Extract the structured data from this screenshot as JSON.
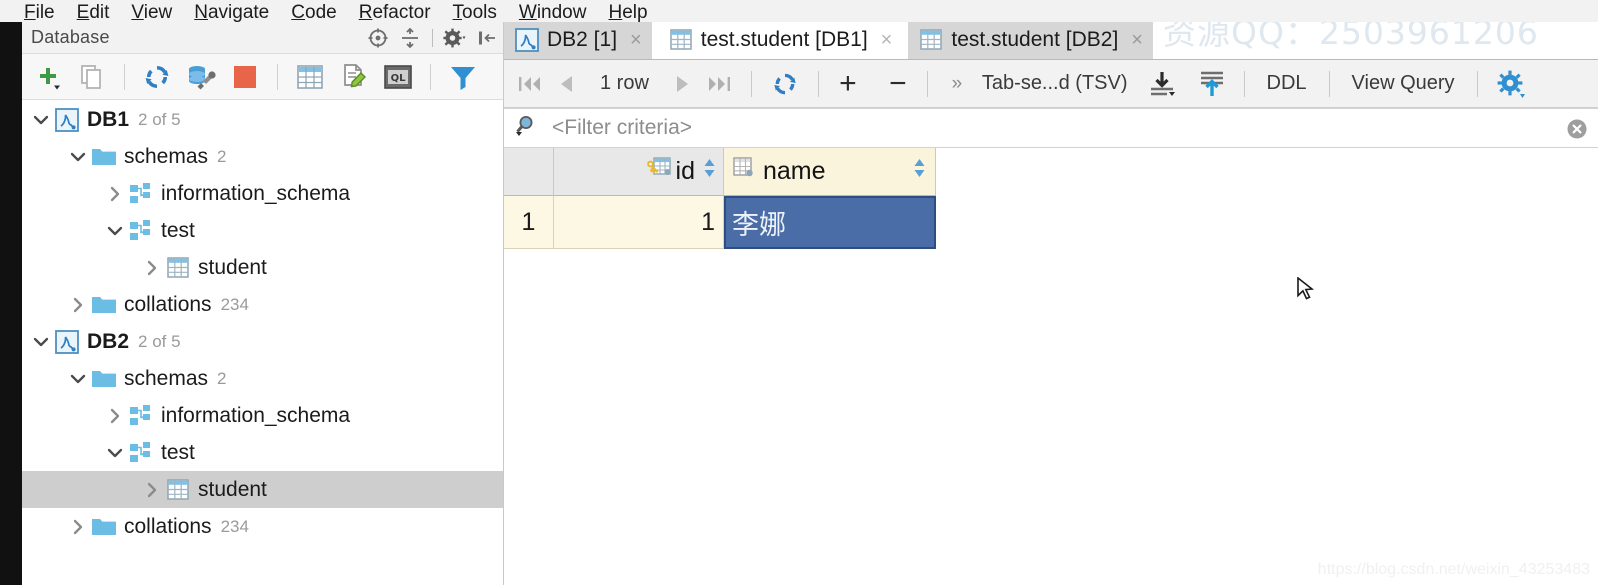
{
  "menubar": {
    "items": [
      {
        "mnemonic": "F",
        "rest": "ile"
      },
      {
        "mnemonic": "E",
        "rest": "dit"
      },
      {
        "mnemonic": "V",
        "rest": "iew"
      },
      {
        "mnemonic": "N",
        "rest": "avigate"
      },
      {
        "mnemonic": "C",
        "rest": "ode"
      },
      {
        "mnemonic": "R",
        "rest": "efactor"
      },
      {
        "mnemonic": "T",
        "rest": "ools"
      },
      {
        "mnemonic": "W",
        "rest": "indow"
      },
      {
        "mnemonic": "H",
        "rest": "elp"
      }
    ]
  },
  "database_panel": {
    "title": "Database",
    "header_icons": [
      "locate-icon",
      "collapse-all-icon",
      "settings-gear-icon",
      "hide-panel-icon"
    ],
    "toolbar_icons": [
      "add-plus-icon",
      "duplicate-icon",
      "synchronize-icon",
      "data-source-properties-icon",
      "stop-icon",
      "table-editor-icon",
      "modify-table-icon",
      "sql-console-icon",
      "filter-icon"
    ],
    "tree": [
      {
        "label": "DB1",
        "count": "2 of 5",
        "icon": "mysql-datasource-icon",
        "depth": 0,
        "expanded": true,
        "bold": true,
        "selected": false
      },
      {
        "label": "schemas",
        "count": "2",
        "icon": "folder-icon",
        "depth": 1,
        "expanded": true,
        "bold": false,
        "selected": false
      },
      {
        "label": "information_schema",
        "count": "",
        "icon": "schema-icon",
        "depth": 2,
        "expanded": false,
        "bold": false,
        "selected": false
      },
      {
        "label": "test",
        "count": "",
        "icon": "schema-icon",
        "depth": 2,
        "expanded": true,
        "bold": false,
        "selected": false
      },
      {
        "label": "student",
        "count": "",
        "icon": "table-icon",
        "depth": 3,
        "expanded": false,
        "bold": false,
        "selected": false
      },
      {
        "label": "collations",
        "count": "234",
        "icon": "folder-icon",
        "depth": 1,
        "expanded": false,
        "bold": false,
        "selected": false
      },
      {
        "label": "DB2",
        "count": "2 of 5",
        "icon": "mysql-datasource-icon",
        "depth": 0,
        "expanded": true,
        "bold": true,
        "selected": false
      },
      {
        "label": "schemas",
        "count": "2",
        "icon": "folder-icon",
        "depth": 1,
        "expanded": true,
        "bold": false,
        "selected": false
      },
      {
        "label": "information_schema",
        "count": "",
        "icon": "schema-icon",
        "depth": 2,
        "expanded": false,
        "bold": false,
        "selected": false
      },
      {
        "label": "test",
        "count": "",
        "icon": "schema-icon",
        "depth": 2,
        "expanded": true,
        "bold": false,
        "selected": false
      },
      {
        "label": "student",
        "count": "",
        "icon": "table-icon",
        "depth": 3,
        "expanded": false,
        "bold": false,
        "selected": true
      },
      {
        "label": "collations",
        "count": "234",
        "icon": "folder-icon",
        "depth": 1,
        "expanded": false,
        "bold": false,
        "selected": false
      }
    ]
  },
  "editor": {
    "tabs": [
      {
        "label": "DB2 [1]",
        "icon": "mysql-datasource-icon",
        "active": false,
        "close": "×"
      },
      {
        "label": "test.student [DB1]",
        "icon": "table-icon",
        "active": true,
        "close": "×"
      },
      {
        "label": "test.student [DB2]",
        "icon": "table-icon",
        "active": false,
        "close": "×"
      }
    ],
    "toolbar": {
      "first_page": "first-page-icon",
      "prev_page": "prev-page-icon",
      "row_count": "1 row",
      "next_page": "next-page-icon",
      "last_page": "last-page-icon",
      "reload": "reload-icon",
      "add_row": "+",
      "delete_row": "−",
      "overflow": "»",
      "format_label": "Tab-se...d (TSV)",
      "export_icon": "export-data-icon",
      "import_icon": "import-data-icon",
      "ddl_label": "DDL",
      "view_query_label": "View Query",
      "settings_icon": "settings-gear-icon"
    },
    "filter": {
      "icon": "filter-search-icon",
      "placeholder": "<Filter criteria>",
      "clear_icon": "clear-filter-icon"
    }
  },
  "result_grid": {
    "row_header": "",
    "columns": [
      {
        "name": "id",
        "icon": "primary-key-column-icon",
        "sort": "⇅"
      },
      {
        "name": "name",
        "icon": "column-icon",
        "sort": "⇅"
      }
    ],
    "rows": [
      {
        "num": "1",
        "id": "1",
        "name": "李娜"
      }
    ],
    "selected_cell": {
      "row": "1",
      "column": "name",
      "value": "李娜"
    }
  },
  "watermarks": {
    "top": "资源QQ：2503961206",
    "bottom": "https://blog.csdn.net/weixin_43253483"
  },
  "colors": {
    "selection_blue": "#4a6da7",
    "tree_selection_gray": "#cecece",
    "header_gray": "#e8e8e8",
    "row_cream": "#fdf8e4",
    "name_header_cream": "#fbf4dd",
    "accent_blue": "#3c8fd6",
    "folder_blue": "#6bbde4"
  }
}
